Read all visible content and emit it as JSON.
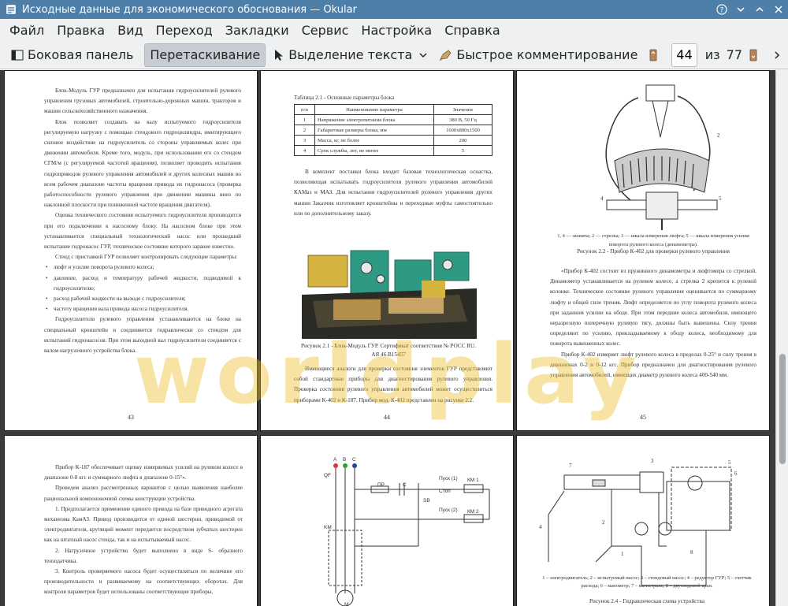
{
  "window": {
    "title": "Исходные данные для экономического обоснования  — Okular"
  },
  "menu": [
    "Файл",
    "Правка",
    "Вид",
    "Переход",
    "Закладки",
    "Сервис",
    "Настройка",
    "Справка"
  ],
  "toolbar": {
    "sidebar_label": "Боковая панель",
    "drag_label": "Перетаскивание",
    "select_label": "Выделение текста",
    "comment_label": "Быстрое комментирование",
    "page_current": "44",
    "page_of": "из",
    "page_total": "77"
  },
  "watermark": "worldplay",
  "pages": {
    "p43": {
      "paras": [
        "Блок-Модуль ГУР предназначен для испытания гидроусилителей рулевого управления грузовых автомобилей, строительно-дорожных машин, тракторов и машин сельскохозяйственного назначения.",
        "Блок позволяет создавать на валу испытуемого гидроусилителя регулируемую нагрузку с помощью стендового гидроцилиндра, имитирующего силовое воздействие на гидроусилитель со стороны управляемых колес при движении автомобиля. Кроме того, модуль, при использовании его со стендом СГМ/м (с регулируемой частотой вращения), позволяет проводить испытания гидроприводов рулевого управления автомобилей и других колесных машин во всем рабочем диапазоне частоты вращения привода их гидронасоса (проверка работоспособности рулевого управления при движении машины вниз по наклонной плоскости при пониженной частоте вращения двигателя).",
        "Оценка технического состояния испытуемого гидроусилителя производится при его подключении к насосному блоку. На насосном блоке при этом устанавливается специальный технологический насос или прошедший испытание гидронасос ГУР, техническое состояние которого заранее известно.",
        "Стенд с приставкой ГУР позволяет контролировать следующие параметры:"
      ],
      "bullets": [
        "люфт и усилие поворота рулевого колеса;",
        "давление, расход и температуру рабочей жидкости, подводимой к гидроусилителю;",
        "расход рабочей жидкости на выходе с гидроусилителя;",
        "частоту вращения вала привода насоса гидроусилителя."
      ],
      "after": "Гидроусилители рулевого управления устанавливаются на блоке на специальный кронштейн и соединяются гидравлически со стендом для испытаний гидронасосов. При этом выходной вал гидроусилителя соединяется с валом нагрузочного устройства блока.",
      "num": "43"
    },
    "p44": {
      "table_title": "Таблица 2.1 - Основные параметры блока",
      "table_header": [
        "п/п",
        "Наименование параметра",
        "Значение"
      ],
      "table_rows": [
        [
          "1",
          "Напряжение электропитания блока",
          "380 В, 50 Гц"
        ],
        [
          "2",
          "Габаритные размеры блока, мм",
          "1600х800х1500"
        ],
        [
          "3",
          "Масса, кг, не более",
          "200"
        ],
        [
          "4",
          "Срок службы, лет, не менее",
          "5"
        ]
      ],
      "para1": "В комплект поставки блока входит базовая технологическая оснастка, позволяющая испытывать гидроусилители рулевого управления автомобилей КАМаз и МАЗ. Для испытания гидроусилителей рулевого управления других машин Заказчик изготовляет кронштейны и переходные муфты самостоятельно или по дополнительному заказу.",
      "caption": "Рисунок 2.1 - Блок-Модуль ГУР. Сертификат соответствия № РОСС RU. АЯ 46.В15457",
      "para2": "Имеющиеся аналоги для проверки состояния элементов ГУР представляют собой стандартные приборы для диагностирования рулевого управления. Проверка состояния рулевого управления автомобилей может осуществляться приборами К-402 и К-187. Прибор мод. К-402 представлен на рисунке 2.2.",
      "num": "44"
    },
    "p45": {
      "legend": "1, 4 — захваты; 2 — стрелка; 3 — шкала измерения люфта; 5 — шкала измерения усилия поворота рулевого колеса (динамометра).",
      "caption": "Рисунок 2.2 - Прибор К-402 для проверки рулевого управления",
      "para1": "«Прибор К-402 состоит из пружинного динамометра и люфтомера со стрелкой. Динамометр устанавливается на рулевом колесе, а стрелка 2 крепится к рулевой колонке. Техническое состояние рулевого управления оценивается по суммарному люфту и общей силе трения. Люфт определяется по углу поворота рулевого колеса при заданном усилии на ободе. При этом передние колеса автомобиля, имеющего неразрезную поперечную рулевую тягу, должны быть вывешены. Силу трения определяют по усилию, прикладываемому к ободу колеса, необходимому для поворота вывешенных колес.",
      "para2": "Прибор К-402 измеряет люфт рулевого колеса в пределах 0-25° и силу трения в диапазонах 0-2 и 0-12 кгс. Прибор предназначен для диагностирования рулевого управления автомобилей, имеющих диаметр рулевого колеса 400-540 мм.",
      "num": "45"
    },
    "p46": {
      "paras": [
        "Прибор К-187 обеспечивает оценку измеряемых усилий на рулевом колесе в диапазоне 0-8 кгс и суммарного люфта в диапазоне 0-15°».",
        "Проведем анализ рассмотренных вариантов с целью выявления наиболее рациональной компоновочной схемы конструкции устройства.",
        "1. Предполагается применение единого привода на базе приводного агрегата механизма КамАЗ. Привод производится от единой шестерни, приводимой от электродвигателя, крутящий момент передается посредством зубчатых шестерен как на штатный насос стенда, так и на испытываемый насос.",
        "2. Нагрузочное устройство будет выполнено в виде S- образного тензодатчика.",
        "3. Контроль проверяемого насоса будет осуществляться по величине его производительности и развиваемому на соответствующих оборотах. Для контроля параметров будет использованы соответствующие приборы."
      ]
    },
    "p47": {
      "labels": [
        "A",
        "B",
        "C",
        "QF",
        "ПР",
        "С",
        "Пуск (1)",
        "Стоп",
        "КМ 1",
        "Пуск (2)",
        "КМ 2",
        "SB",
        "KM",
        "М"
      ]
    },
    "p48": {
      "numbers": [
        "1",
        "2",
        "3",
        "4",
        "5",
        "6",
        "7",
        "8"
      ],
      "legend": "1 – электродвигатель; 2 – испытуемый насос; 3 – стендовый насос; 4 – редуктор ГУР; 5 – счетчик расхода; 6 – манометр; 7 – магистраль; 8 – двухходовой кран.",
      "caption": "Рисунок 2.4 - Гидравлическая схема устройства"
    }
  },
  "colors": {
    "titlebar": "#4d7fa8",
    "watermark": "#ebbe28",
    "photo_green": "#2f9a84",
    "photo_yellow": "#d4b341"
  }
}
